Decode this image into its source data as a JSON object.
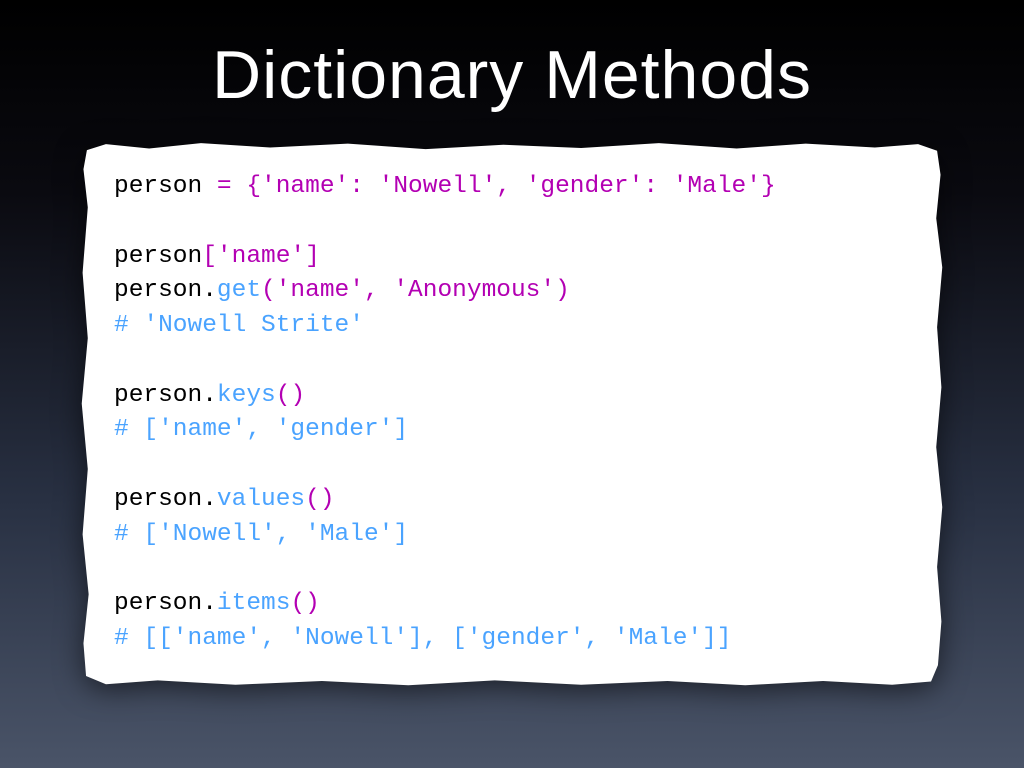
{
  "title": "Dictionary Methods",
  "code": {
    "l1_var": "person",
    "l1_eq": " = ",
    "l1_ob": "{",
    "l1_k1": "'name'",
    "l1_c1": ": ",
    "l1_v1": "'Nowell'",
    "l1_cm": ", ",
    "l1_k2": "'gender'",
    "l1_c2": ": ",
    "l1_v2": "'Male'",
    "l1_cb": "}",
    "l3_var": "person",
    "l3_ob": "[",
    "l3_key": "'name'",
    "l3_cb": "]",
    "l4_var": "person",
    "l4_dot": ".",
    "l4_meth": "get",
    "l4_op": "(",
    "l4_a1": "'name'",
    "l4_cm": ", ",
    "l4_a2": "'Anonymous'",
    "l4_cp": ")",
    "l5_cmt": "# 'Nowell Strite'",
    "l7_var": "person",
    "l7_dot": ".",
    "l7_meth": "keys",
    "l7_op": "(",
    "l7_cp": ")",
    "l8_cmt": "# ['name', 'gender']",
    "l10_var": "person",
    "l10_dot": ".",
    "l10_meth": "values",
    "l10_op": "(",
    "l10_cp": ")",
    "l11_cmt": "# ['Nowell', 'Male']",
    "l13_var": "person",
    "l13_dot": ".",
    "l13_meth": "items",
    "l13_op": "(",
    "l13_cp": ")",
    "l14_cmt": "# [['name', 'Nowell'], ['gender', 'Male']]"
  }
}
